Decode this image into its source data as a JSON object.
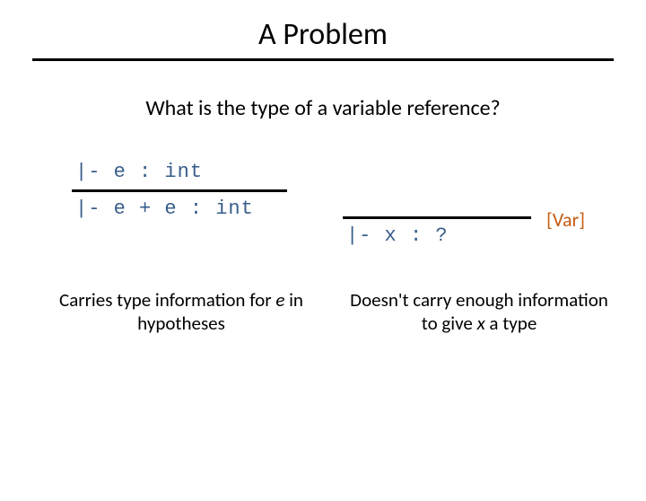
{
  "title": "A Problem",
  "subtitle": "What is the type of a variable reference?",
  "left_rule": {
    "premise": "|- e : int",
    "conclusion": "|- e + e : int"
  },
  "right_rule": {
    "premise": "",
    "conclusion": "|- x : ?",
    "label": "[Var]"
  },
  "captions": {
    "left": {
      "pre": "Carries type information for ",
      "em": "e",
      "post": " in hypotheses"
    },
    "right": {
      "pre": "Doesn't carry enough information to give ",
      "em": "x",
      "post": " a type"
    }
  }
}
